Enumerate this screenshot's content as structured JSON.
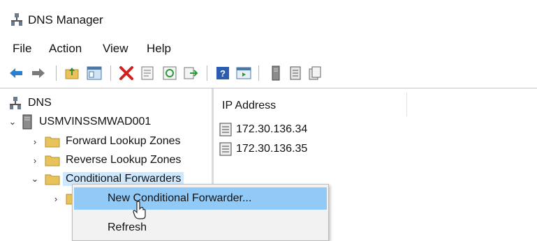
{
  "window": {
    "title": "DNS Manager"
  },
  "menubar": {
    "items": [
      "File",
      "Action",
      "View",
      "Help"
    ]
  },
  "toolbar": {
    "icons": [
      "back-arrow-icon",
      "forward-arrow-icon",
      "up-folder-icon",
      "show-hide-tree-icon",
      "delete-icon",
      "properties-icon",
      "refresh-icon",
      "export-list-icon",
      "help-icon",
      "console-icon",
      "server-icon",
      "list-icon",
      "copy-icon"
    ]
  },
  "tree": {
    "root_label": "DNS",
    "server_label": "USMVINSSMWAD001",
    "children": [
      "Forward Lookup Zones",
      "Reverse Lookup Zones",
      "Conditional Forwarders"
    ],
    "selected": "Conditional Forwarders"
  },
  "list": {
    "column_header": "IP Address",
    "rows": [
      "172.30.136.34",
      "172.30.136.35"
    ]
  },
  "context_menu": {
    "items": [
      "New Conditional Forwarder...",
      "Refresh"
    ],
    "highlighted": "New Conditional Forwarder..."
  },
  "colors": {
    "selection": "#cde8ff",
    "menu_highlight": "#91c9f7",
    "folder": "#e8c25a"
  }
}
